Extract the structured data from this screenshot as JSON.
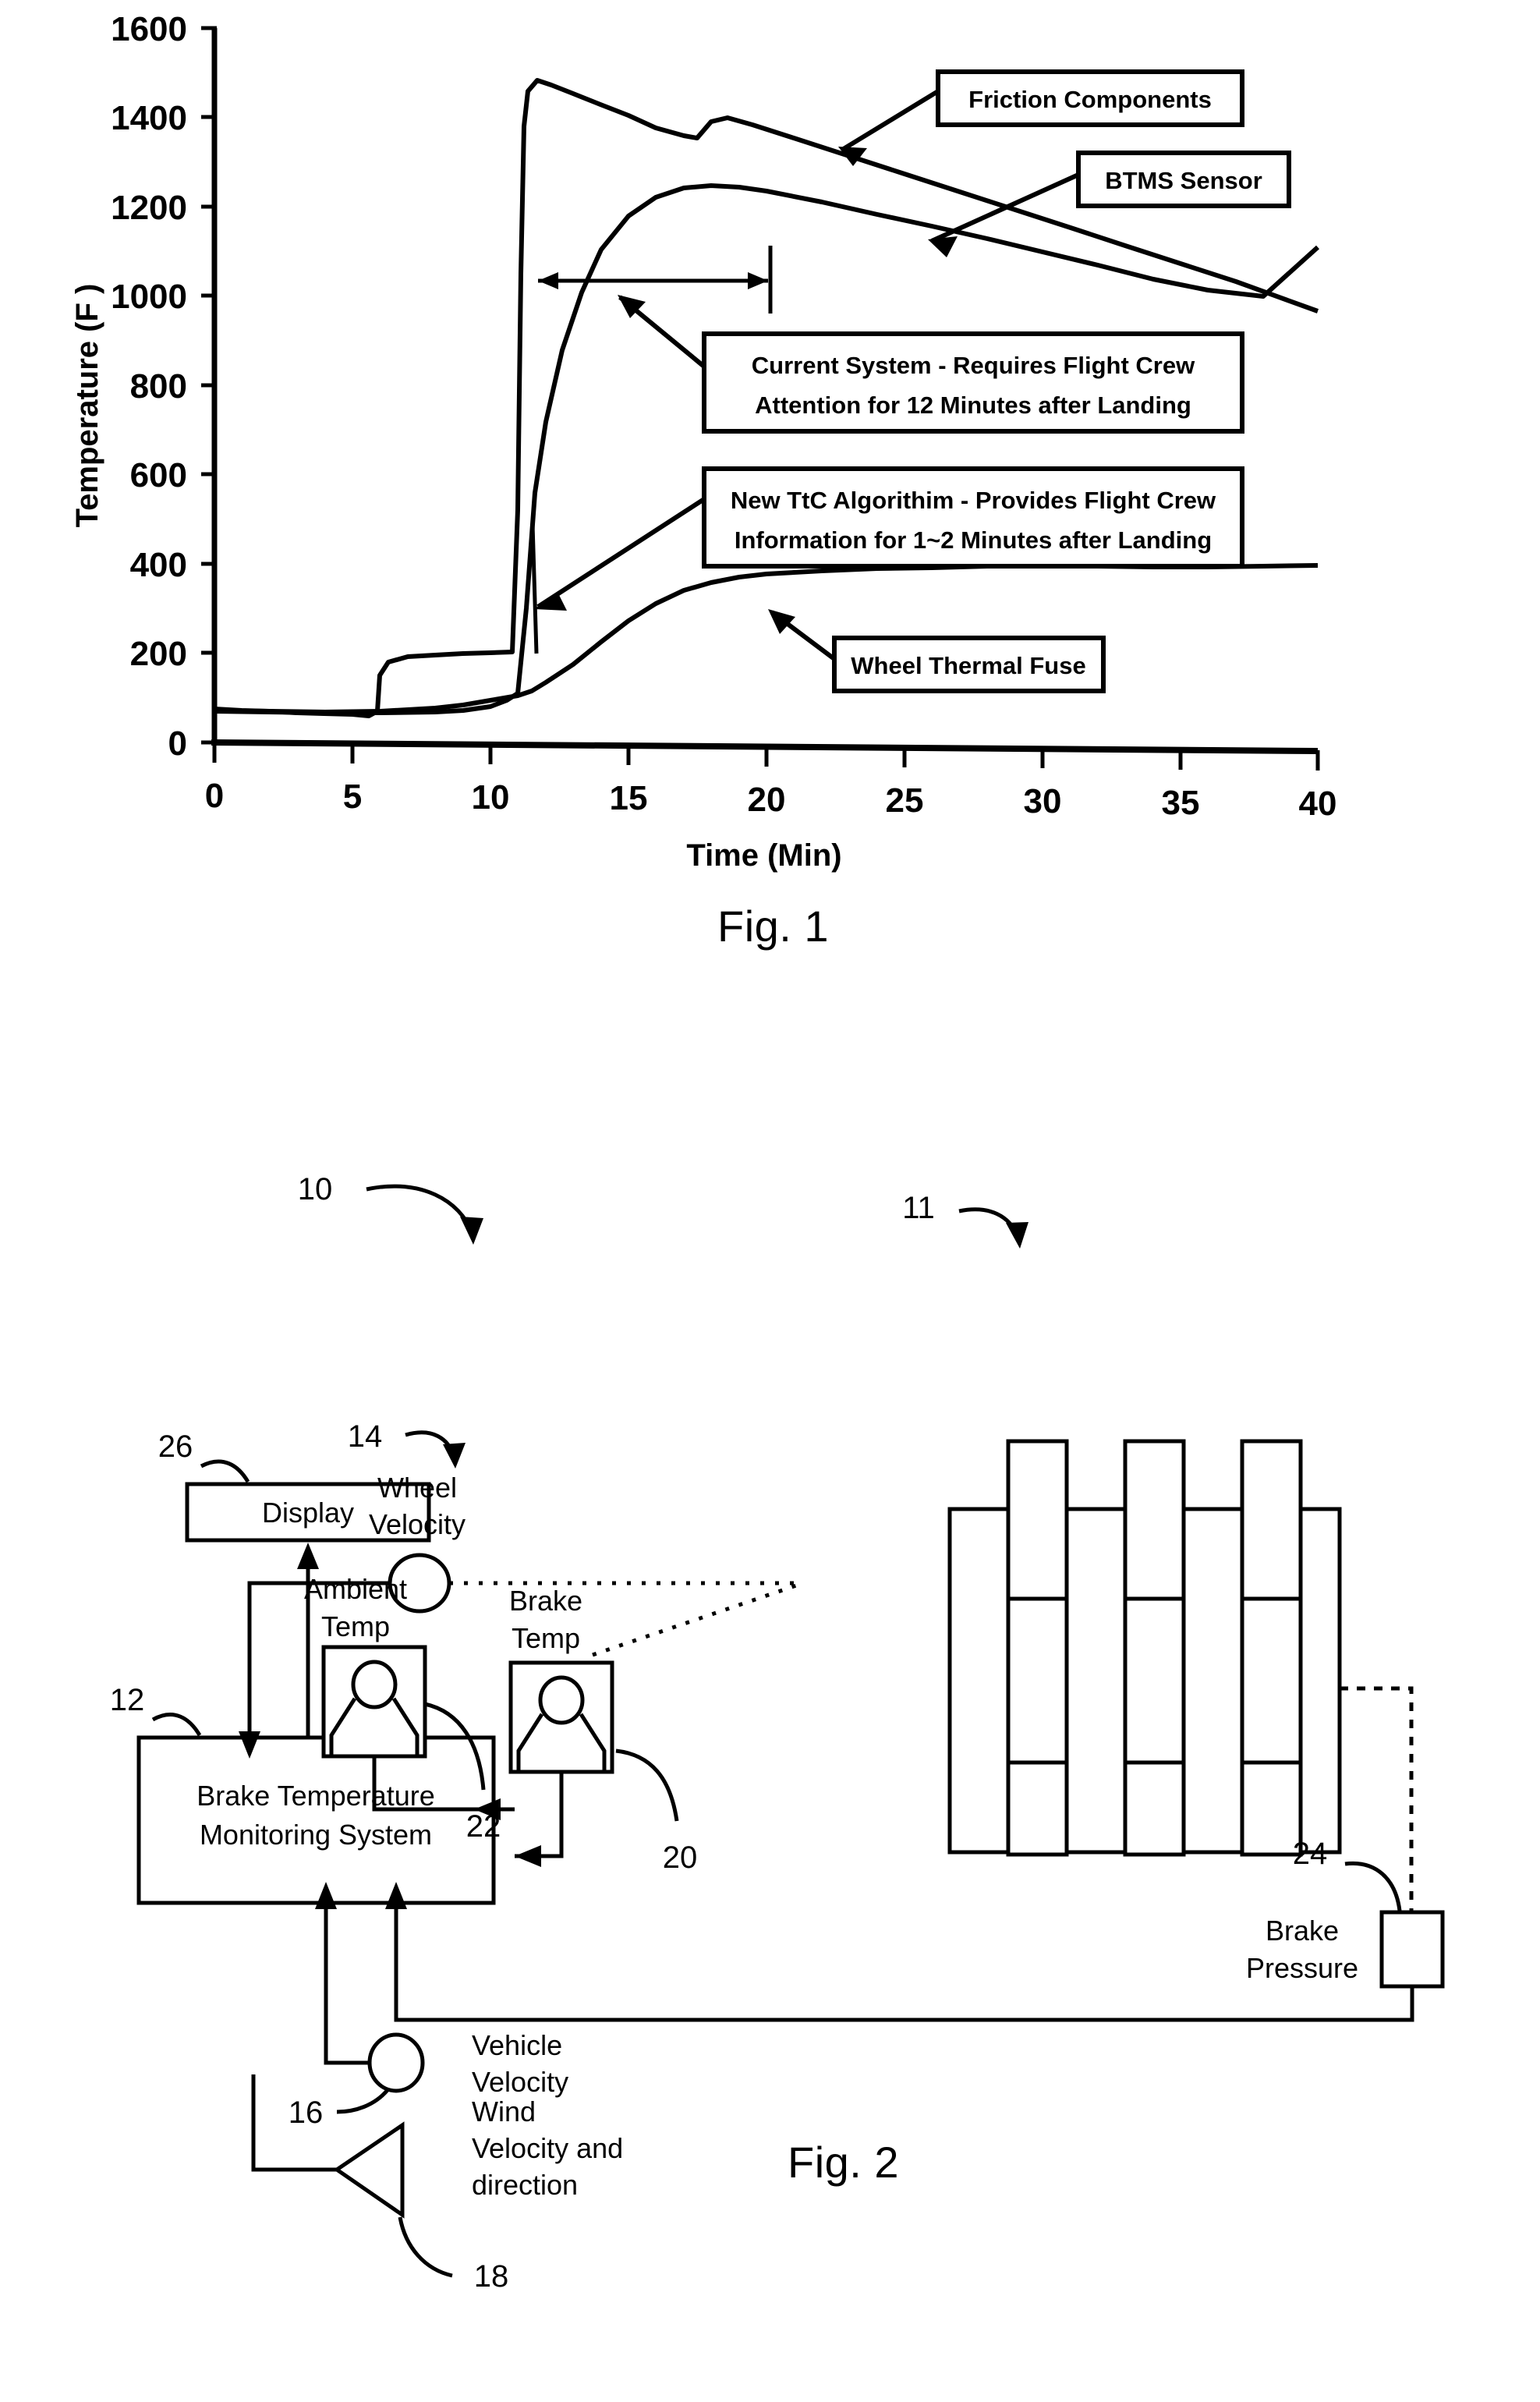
{
  "figure1": {
    "caption": "Fig. 1",
    "axes": {
      "y_label": "Temperature (F )",
      "x_label": "Time (Min)",
      "y_ticks": [
        0,
        200,
        400,
        600,
        800,
        1000,
        1200,
        1400,
        1600
      ],
      "x_ticks": [
        0,
        5,
        10,
        15,
        20,
        25,
        30,
        35,
        40
      ]
    },
    "callouts": {
      "friction_components": "Friction Components",
      "btms_sensor": "BTMS Sensor",
      "current_system_line1": "Current System - Requires Flight Crew",
      "current_system_line2": "Attention for 12  Minutes after Landing",
      "new_ttc_line1": "New TtC Algorithim - Provides Flight Crew",
      "new_ttc_line2": "Information for 1~2  Minutes  after Landing",
      "wheel_thermal_fuse": "Wheel Thermal Fuse"
    }
  },
  "chart_data": {
    "type": "line",
    "title": "",
    "xlabel": "Time (Min)",
    "ylabel": "Temperature (F )",
    "xlim": [
      0,
      40
    ],
    "ylim": [
      0,
      1600
    ],
    "xticks": [
      0,
      5,
      10,
      15,
      20,
      25,
      30,
      35,
      40
    ],
    "yticks": [
      0,
      200,
      400,
      600,
      800,
      1000,
      1200,
      1400,
      1600
    ],
    "grid": false,
    "legend": "none (inline labeled callout boxes)",
    "span_annotation": {
      "label": "Current System - Requires Flight Crew Attention for 12  Minutes after Landing",
      "x_start": 11,
      "x_end": 19.5,
      "y": 1100
    },
    "series": [
      {
        "name": "Friction Components",
        "points": [
          [
            0,
            75
          ],
          [
            1,
            72
          ],
          [
            2,
            70
          ],
          [
            3,
            68
          ],
          [
            4,
            66
          ],
          [
            5,
            65
          ],
          [
            5.6,
            64
          ],
          [
            5.9,
            70
          ],
          [
            6.0,
            150
          ],
          [
            6.3,
            180
          ],
          [
            7,
            192
          ],
          [
            8,
            196
          ],
          [
            9,
            198
          ],
          [
            10,
            200
          ],
          [
            10.8,
            202
          ],
          [
            11.0,
            520
          ],
          [
            11.1,
            1050
          ],
          [
            11.2,
            1380
          ],
          [
            11.35,
            1460
          ],
          [
            11.7,
            1485
          ],
          [
            12.2,
            1475
          ],
          [
            13,
            1455
          ],
          [
            14,
            1430
          ],
          [
            15,
            1405
          ],
          [
            16,
            1378
          ],
          [
            17,
            1360
          ],
          [
            17.5,
            1355
          ],
          [
            18,
            1392
          ],
          [
            18.6,
            1400
          ],
          [
            19.5,
            1385
          ],
          [
            21,
            1355
          ],
          [
            23,
            1315
          ],
          [
            25,
            1275
          ],
          [
            27,
            1235
          ],
          [
            29,
            1195
          ],
          [
            31,
            1155
          ],
          [
            33,
            1115
          ],
          [
            35,
            1075
          ],
          [
            37,
            1035
          ],
          [
            40,
            970
          ]
        ]
      },
      {
        "name": "BTMS Sensor",
        "points": [
          [
            0,
            70
          ],
          [
            2,
            68
          ],
          [
            4,
            66
          ],
          [
            6,
            66
          ],
          [
            8,
            68
          ],
          [
            9,
            72
          ],
          [
            10,
            80
          ],
          [
            10.6,
            95
          ],
          [
            11.0,
            110
          ],
          [
            11.3,
            300
          ],
          [
            11.6,
            560
          ],
          [
            12,
            720
          ],
          [
            12.6,
            880
          ],
          [
            13.3,
            1010
          ],
          [
            14,
            1105
          ],
          [
            15,
            1180
          ],
          [
            16,
            1222
          ],
          [
            17,
            1243
          ],
          [
            18,
            1248
          ],
          [
            19,
            1245
          ],
          [
            20,
            1237
          ],
          [
            22,
            1212
          ],
          [
            24,
            1185
          ],
          [
            26,
            1158
          ],
          [
            28,
            1130
          ],
          [
            30,
            1100
          ],
          [
            32,
            1070
          ],
          [
            34,
            1040
          ],
          [
            36,
            1015
          ],
          [
            38,
            1000
          ],
          [
            40,
            1110
          ]
        ]
      },
      {
        "name": "Wheel Thermal Fuse",
        "points": [
          [
            0,
            72
          ],
          [
            2,
            70
          ],
          [
            4,
            68
          ],
          [
            6,
            70
          ],
          [
            8,
            78
          ],
          [
            9,
            85
          ],
          [
            10,
            95
          ],
          [
            11,
            105
          ],
          [
            11.5,
            115
          ],
          [
            12,
            135
          ],
          [
            13,
            175
          ],
          [
            14,
            225
          ],
          [
            15,
            272
          ],
          [
            16,
            310
          ],
          [
            17,
            340
          ],
          [
            18,
            358
          ],
          [
            19,
            370
          ],
          [
            20,
            378
          ],
          [
            22,
            384
          ],
          [
            24,
            388
          ],
          [
            26,
            390
          ],
          [
            28,
            393
          ],
          [
            30,
            396
          ],
          [
            32,
            393
          ],
          [
            34,
            392
          ],
          [
            36,
            392
          ],
          [
            38,
            393
          ],
          [
            40,
            394
          ]
        ]
      },
      {
        "name": "spike-marker",
        "points": [
          [
            11.6,
            490
          ],
          [
            11.7,
            200
          ]
        ]
      }
    ]
  },
  "figure2": {
    "caption": "Fig. 2",
    "blocks": {
      "display": "Display",
      "btms_line1": "Brake Temperature",
      "btms_line2": "Monitoring System"
    },
    "labels": {
      "wheel_velocity_l1": "Wheel",
      "wheel_velocity_l2": "Velocity",
      "ambient_temp_l1": "Ambient",
      "ambient_temp_l2": "Temp",
      "brake_temp_l1": "Brake",
      "brake_temp_l2": "Temp",
      "brake_pressure_l1": "Brake",
      "brake_pressure_l2": "Pressure",
      "vehicle_velocity_l1": "Vehicle",
      "vehicle_velocity_l2": "Velocity",
      "wind_l1": "Wind",
      "wind_l2": "Velocity and",
      "wind_l3": "direction"
    },
    "reference_numerals": {
      "system": "10",
      "brake_stack": "11",
      "btms": "12",
      "wheel_velocity": "14",
      "vehicle_velocity": "16",
      "wind_sensor": "18",
      "brake_temp_sensor": "20",
      "ambient_temp_sensor": "22",
      "brake_pressure_sensor": "24",
      "display": "26"
    }
  }
}
